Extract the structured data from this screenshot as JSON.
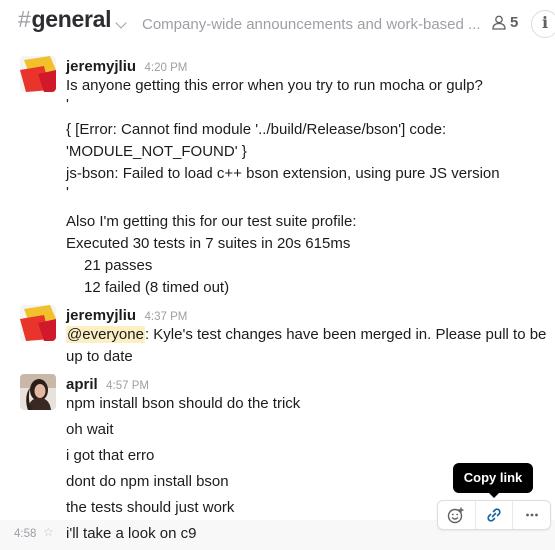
{
  "header": {
    "hash": "#",
    "channel_name": "general",
    "topic": "Company-wide announcements and work-based ...",
    "member_count": "5"
  },
  "messages": [
    {
      "author": "jeremyjliu",
      "time": "4:20 PM",
      "lines": [
        "Is anyone getting this error when you try to run mocha or gulp?",
        "'",
        "{ [Error: Cannot find module '../build/Release/bson'] code:",
        "'MODULE_NOT_FOUND' }",
        "js-bson: Failed to load c++ bson extension, using pure JS version",
        "'",
        "Also I'm getting this for our test suite profile:",
        "Executed 30 tests in 7 suites in 20s 615ms",
        "21 passes",
        "12 failed (8 timed out)"
      ]
    },
    {
      "author": "jeremyjliu",
      "time": "4:37 PM",
      "mention": "@everyone",
      "line1_rest": ": Kyle's test changes have been merged in. Please pull to be",
      "line2": "up to date"
    },
    {
      "author": "april",
      "time": "4:57 PM",
      "lines": [
        "npm install bson should do the trick",
        "oh wait",
        "i got that erro",
        "dont do npm install bson",
        "the tests should just work",
        "i'll take  a look on c9"
      ],
      "hover_time": "4:58"
    }
  ],
  "tooltip": {
    "text": "Copy link"
  },
  "icons": {
    "members": "person-icon",
    "info": "info-icon",
    "reaction": "add-reaction-icon",
    "link": "link-icon",
    "more": "more-actions-icon",
    "star": "star-icon"
  },
  "colors": {
    "link_accent": "#1264a3",
    "mention_bg": "#fcefc4",
    "tooltip_bg": "#000000"
  }
}
